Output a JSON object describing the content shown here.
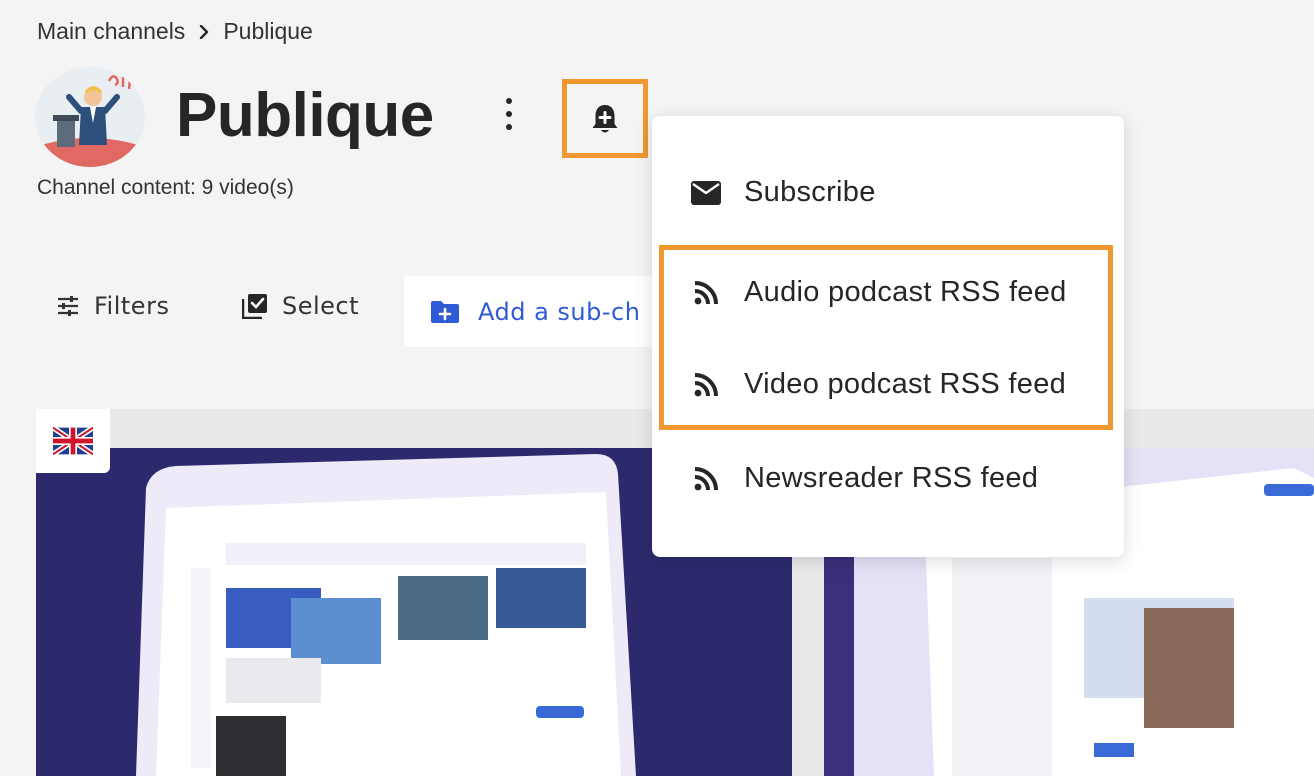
{
  "breadcrumb": {
    "parent": "Main channels",
    "current": "Publique"
  },
  "header": {
    "title": "Publique",
    "channel_content": "Channel content: 9 video(s)"
  },
  "toolbar": {
    "filters_label": "Filters",
    "select_label": "Select",
    "add_sub_label": "Add a sub-ch"
  },
  "menu": {
    "items": [
      {
        "label": "Subscribe",
        "icon": "envelope-icon"
      },
      {
        "label": "Audio podcast RSS feed",
        "icon": "rss-icon"
      },
      {
        "label": "Video podcast RSS feed",
        "icon": "rss-icon"
      },
      {
        "label": "Newsreader RSS feed",
        "icon": "rss-icon"
      }
    ]
  },
  "colors": {
    "highlight": "#f0972f",
    "accent": "#2f5bd7",
    "thumb_dark": "#2c2a6d",
    "thumb_light": "#e6e1f7"
  }
}
